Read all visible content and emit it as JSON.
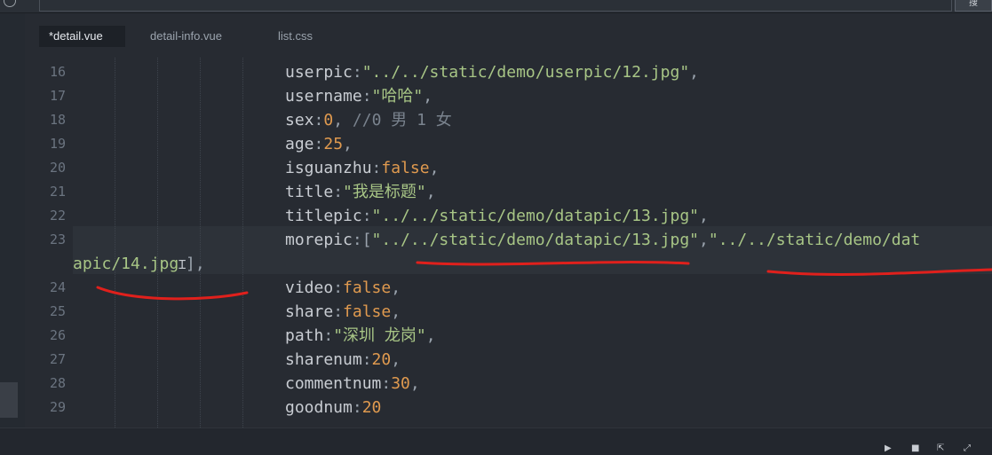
{
  "tabs": [
    {
      "label": "*detail.vue",
      "active": true
    },
    {
      "label": "detail-info.vue",
      "active": false
    },
    {
      "label": "list.css",
      "active": false
    }
  ],
  "topbar": {
    "right_button": "搜"
  },
  "lines": [
    {
      "num": "16",
      "tokens": [
        [
          "k",
          "userpic"
        ],
        [
          "p",
          ":"
        ],
        [
          "s",
          "\"../../static/demo/userpic/12.jpg\""
        ],
        [
          "p",
          ","
        ]
      ]
    },
    {
      "num": "17",
      "tokens": [
        [
          "k",
          "username"
        ],
        [
          "p",
          ":"
        ],
        [
          "s",
          "\"哈哈\""
        ],
        [
          "p",
          ","
        ]
      ]
    },
    {
      "num": "18",
      "tokens": [
        [
          "k",
          "sex"
        ],
        [
          "p",
          ":"
        ],
        [
          "n",
          "0"
        ],
        [
          "p",
          ", "
        ],
        [
          "c",
          "//0 男 1 女"
        ]
      ]
    },
    {
      "num": "19",
      "tokens": [
        [
          "k",
          "age"
        ],
        [
          "p",
          ":"
        ],
        [
          "n",
          "25"
        ],
        [
          "p",
          ","
        ]
      ]
    },
    {
      "num": "20",
      "tokens": [
        [
          "k",
          "isguanzhu"
        ],
        [
          "p",
          ":"
        ],
        [
          "n",
          "false"
        ],
        [
          "p",
          ","
        ]
      ]
    },
    {
      "num": "21",
      "tokens": [
        [
          "k",
          "title"
        ],
        [
          "p",
          ":"
        ],
        [
          "s",
          "\"我是标题\""
        ],
        [
          "p",
          ","
        ]
      ]
    },
    {
      "num": "22",
      "tokens": [
        [
          "k",
          "titlepic"
        ],
        [
          "p",
          ":"
        ],
        [
          "s",
          "\"../../static/demo/datapic/13.jpg\""
        ],
        [
          "p",
          ","
        ]
      ]
    },
    {
      "num": "23",
      "tokens": [
        [
          "k",
          "morepic"
        ],
        [
          "p",
          ":["
        ],
        [
          "s",
          "\"../../static/demo/datapic/13.jpg\""
        ],
        [
          "p",
          ","
        ],
        [
          "s",
          "\"../../static/demo/dat"
        ]
      ]
    },
    {
      "num": "",
      "wrap": true,
      "tokens": [
        [
          "s",
          "apic/14.jpg"
        ],
        [
          "cur",
          "Ɪ"
        ],
        [
          "p",
          "],"
        ]
      ]
    },
    {
      "num": "24",
      "tokens": [
        [
          "k",
          "video"
        ],
        [
          "p",
          ":"
        ],
        [
          "n",
          "false"
        ],
        [
          "p",
          ","
        ]
      ]
    },
    {
      "num": "25",
      "tokens": [
        [
          "k",
          "share"
        ],
        [
          "p",
          ":"
        ],
        [
          "n",
          "false"
        ],
        [
          "p",
          ","
        ]
      ]
    },
    {
      "num": "26",
      "tokens": [
        [
          "k",
          "path"
        ],
        [
          "p",
          ":"
        ],
        [
          "s",
          "\"深圳 龙岗\""
        ],
        [
          "p",
          ","
        ]
      ]
    },
    {
      "num": "27",
      "tokens": [
        [
          "k",
          "sharenum"
        ],
        [
          "p",
          ":"
        ],
        [
          "n",
          "20"
        ],
        [
          "p",
          ","
        ]
      ]
    },
    {
      "num": "28",
      "tokens": [
        [
          "k",
          "commentnum"
        ],
        [
          "p",
          ":"
        ],
        [
          "n",
          "30"
        ],
        [
          "p",
          ","
        ]
      ]
    },
    {
      "num": "29",
      "tokens": [
        [
          "k",
          "goodnum"
        ],
        [
          "p",
          ":"
        ],
        [
          "n",
          "20"
        ]
      ]
    }
  ],
  "annotation_color": "#e0201c",
  "status_icons": [
    "run-icon",
    "stop-icon",
    "export-icon",
    "expand-icon"
  ]
}
